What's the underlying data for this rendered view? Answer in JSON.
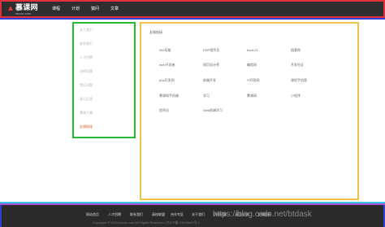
{
  "header": {
    "logo_text": "慕课网",
    "logo_sub": "imooc.com",
    "nav": [
      "课程",
      "计划",
      "猿问",
      "文章"
    ]
  },
  "sidebar": {
    "items": [
      "关于我们",
      "联系我们",
      "人才招聘",
      "讲师招募",
      "常见问题",
      "意见反馈",
      "慕课大事",
      "友情链接"
    ],
    "active_index": 7
  },
  "panel": {
    "title": "友情链接",
    "links": [
      [
        "360导航",
        "PHP程序员",
        "hao123",
        "极客网"
      ],
      [
        "web开发者",
        "网页设计师",
        "编程网",
        "开发社区"
      ],
      [
        "php开发网",
        "前端开发",
        "IT问答网",
        "课程手机版"
      ],
      [
        "慕课网手机端",
        "学习",
        "慕课网",
        "小程序"
      ],
      [
        "程序员",
        "Web前端学习",
        "",
        ""
      ]
    ]
  },
  "footer": {
    "links": [
      "网站首页",
      "人才招聘",
      "联系我们",
      "高校联盟",
      "合作专区",
      "关于我们",
      "讲师招募",
      "意见反馈",
      "友情链接"
    ],
    "copyright": "Copyright © 2018 imooc.com All Rights Reserved | 京ICP备 13046642号-2",
    "watermark": "https://blog.csdn.net/btdask"
  },
  "colors": {
    "header_bg": "#2e2e2e",
    "header_border": "#e0303a",
    "sidebar_border": "#22bb33",
    "panel_border": "#f0c24a",
    "accent": "#e0603a"
  }
}
